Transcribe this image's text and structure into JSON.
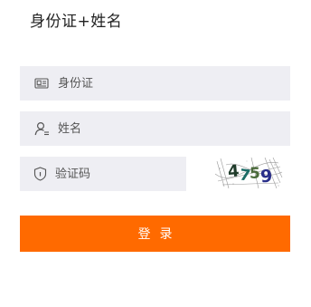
{
  "header": {
    "title": "身份证+姓名"
  },
  "form": {
    "id_card": {
      "placeholder": "身份证",
      "value": ""
    },
    "name": {
      "placeholder": "姓名",
      "value": ""
    },
    "captcha_code": {
      "placeholder": "验证码",
      "value": ""
    },
    "captcha_image_text": "4759",
    "login_label": "登录"
  },
  "icons": {
    "id_card": "id-card-icon",
    "user": "user-icon",
    "shield": "shield-icon"
  },
  "colors": {
    "accent": "#ff6a00",
    "field_bg": "#eeeef3"
  }
}
